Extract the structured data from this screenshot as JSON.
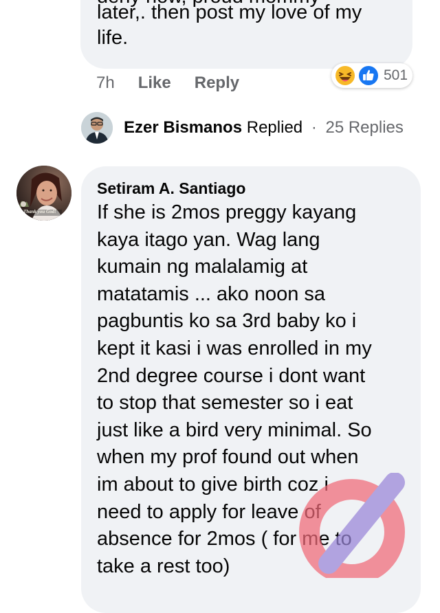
{
  "top_comment": {
    "cut_line": "deny now, proud mommy",
    "line1": "later,. then post my love of my",
    "line2": "life.",
    "time": "7h",
    "like_label": "Like",
    "reply_label": "Reply",
    "reactions": {
      "icons": [
        "haha-icon",
        "like-icon"
      ],
      "count": "501"
    }
  },
  "replies_row": {
    "name": "Ezer Bismanos",
    "replied": "Replied",
    "separator": "·",
    "count": "25 Replies"
  },
  "main_comment": {
    "avatar_caption": "Thank you God!",
    "author": "Setiram A. Santiago",
    "lines": [
      "If she is 2mos preggy kayang",
      "kaya itago yan. Wag lang",
      "kumain ng malalamig at",
      "matatamis ... ako noon sa",
      "pagbuntis ko sa 3rd baby ko i",
      "kept it kasi i was enrolled in my",
      "2nd degree course i dont want",
      "to stop that semester so i eat",
      "just like a bird very minimal. So",
      "when my prof found out when",
      "im about to give birth coz i",
      "need to apply for leave of",
      "absence for 2mos ( for me to",
      "take a rest too)"
    ]
  },
  "colors": {
    "bubble": "#f0f2f5",
    "meta_text": "#65676b",
    "like_blue": "#1877f2",
    "haha_yellow": "#f7b928"
  }
}
